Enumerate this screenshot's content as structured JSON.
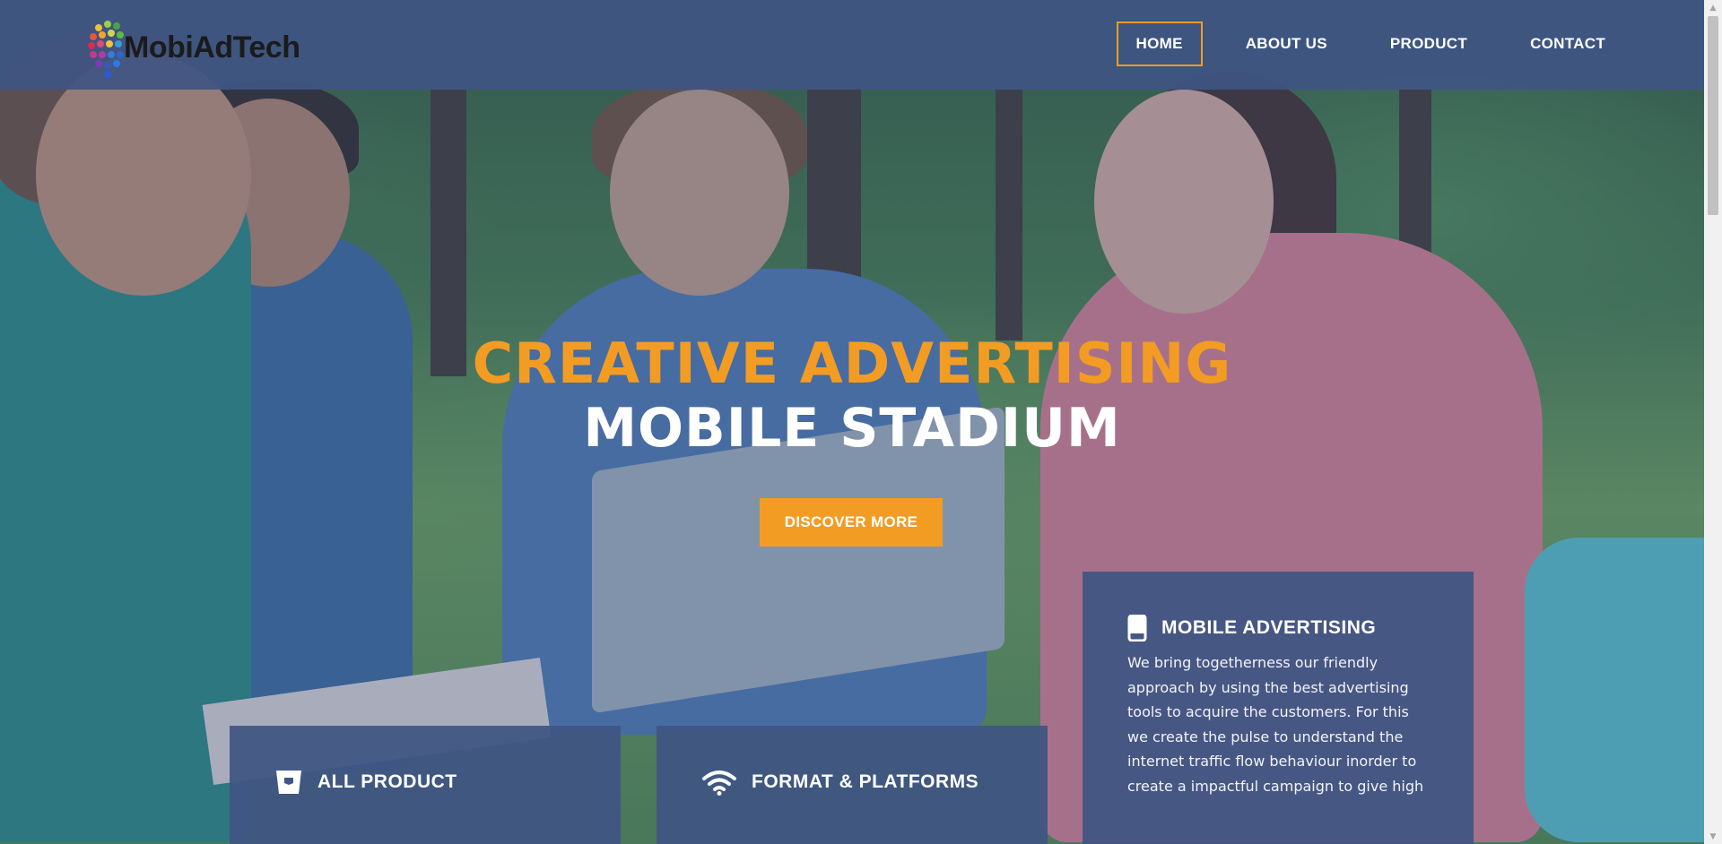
{
  "header": {
    "logo_text": "MobiAdTech",
    "nav": [
      {
        "label": "HOME"
      },
      {
        "label": "ABOUT US"
      },
      {
        "label": "PRODUCT"
      },
      {
        "label": "CONTACT"
      }
    ],
    "active_nav": "HOME"
  },
  "hero": {
    "headline_1": "CREATIVE ADVERTISING",
    "headline_2": "MOBILE STADIUM",
    "cta_label": "DISCOVER MORE"
  },
  "cards": {
    "mobile": {
      "icon": "mobile-phone-icon",
      "title": "MOBILE ADVERTISING",
      "body": "We bring togetherness our friendly approach by using the best advertising tools to acquire the customers. For this we create the pulse to understand the internet traffic flow behaviour inorder to create a impactful campaign to give high"
    },
    "product": {
      "icon": "bucket-icon",
      "title": "ALL PRODUCT"
    },
    "format": {
      "icon": "wifi-icon",
      "title": "FORMAT & PLATFORMS"
    }
  },
  "colors": {
    "accent": "#f39c23",
    "header_bg": "#3f5583",
    "card_bg": "#3f5583",
    "text_light": "#ffffff"
  }
}
